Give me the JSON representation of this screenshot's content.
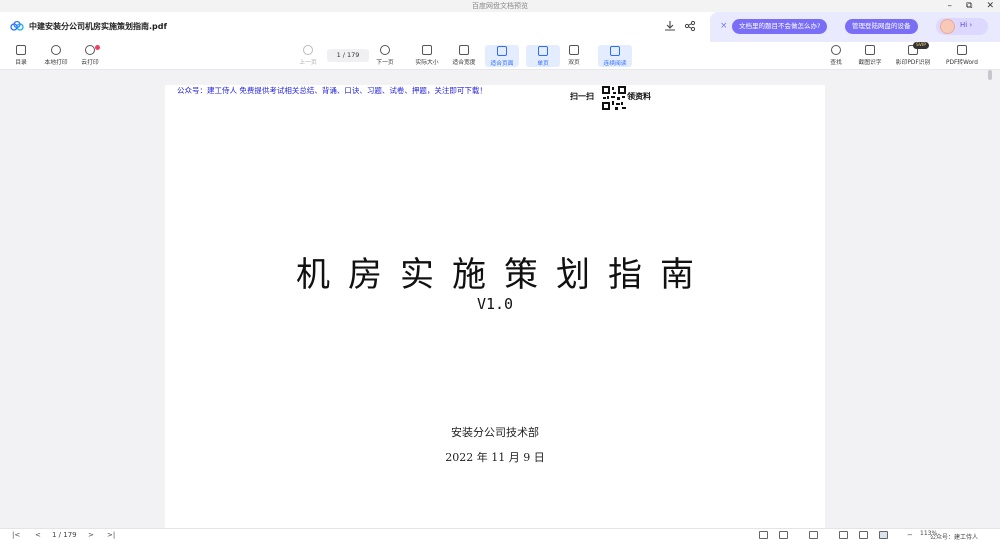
{
  "os": {
    "title": "百度网盘文档预览",
    "minimize": "–",
    "restore": "⧉",
    "close": "✕"
  },
  "header": {
    "doc_title": "中建安装分公司机房实施策划指南.pdf",
    "promo_close": "×",
    "pill1": "文档里的题目不会做怎么办?",
    "pill2": "管理登陆网盘的设备",
    "hi_text": "Hi ›"
  },
  "toolbar": {
    "catalog": "目录",
    "local_print": "本地打印",
    "cloud_print": "云打印",
    "prev_page": "上一页",
    "page_indicator": "1 / 179",
    "next_page": "下一页",
    "actual_size": "实际大小",
    "fit_width": "适合宽度",
    "fit_page": "适合页面",
    "single_page": "单页",
    "double_page": "双页",
    "continuous": "连续阅读",
    "search": "查找",
    "screenshot_ocr": "截图识字",
    "scan_ocr": "影印PDF识别",
    "vip": "SVIP",
    "pdf_to_word": "PDF转Word"
  },
  "document": {
    "notice": "公众号：建工侍人 免费提供考试相关总结、背诵、口诀、习题、试卷、押题，关注即可下载！",
    "scan_left": "扫一扫",
    "scan_right": "领资料",
    "title": "机房实施策划指南",
    "version": "V1.0",
    "department": "安装分公司技术部",
    "date": "2022 年 11 月 9 日"
  },
  "bottom": {
    "first": "|<",
    "prev": "<",
    "page_indicator": "1 / 179",
    "next": ">",
    "last": ">|",
    "zoom_out": "−",
    "zoom": "113%",
    "zoom_in": "+",
    "watermark": "公众号：建工侍人"
  }
}
